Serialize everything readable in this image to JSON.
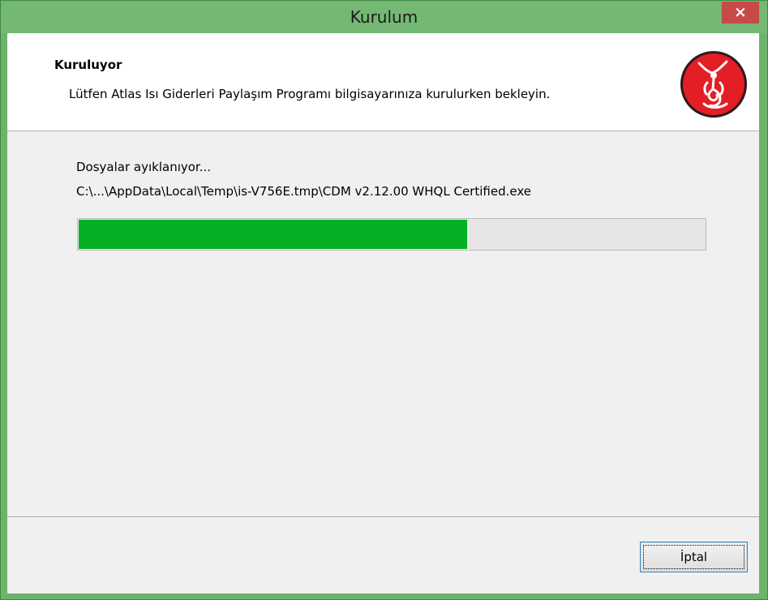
{
  "window": {
    "title": "Kurulum",
    "close_glyph": "×",
    "close_icon": "close-icon"
  },
  "header": {
    "title": "Kuruluyor",
    "subtitle": "Lütfen Atlas Isı Giderleri Paylaşım Programı bilgisayarınıza kurulurken bekleyin.",
    "logo_icon": "app-logo-icon"
  },
  "main": {
    "status": "Dosyalar ayıklanıyor...",
    "file_path": "C:\\...\\AppData\\Local\\Temp\\is-V756E.tmp\\CDM v2.12.00 WHQL Certified.exe",
    "progress_fraction": 0.62
  },
  "footer": {
    "cancel_label": "İptal"
  },
  "colors": {
    "titlebar": "#74b874",
    "close_button": "#c74a49",
    "progress_fill": "#06b025",
    "logo_red": "#e31e24"
  }
}
